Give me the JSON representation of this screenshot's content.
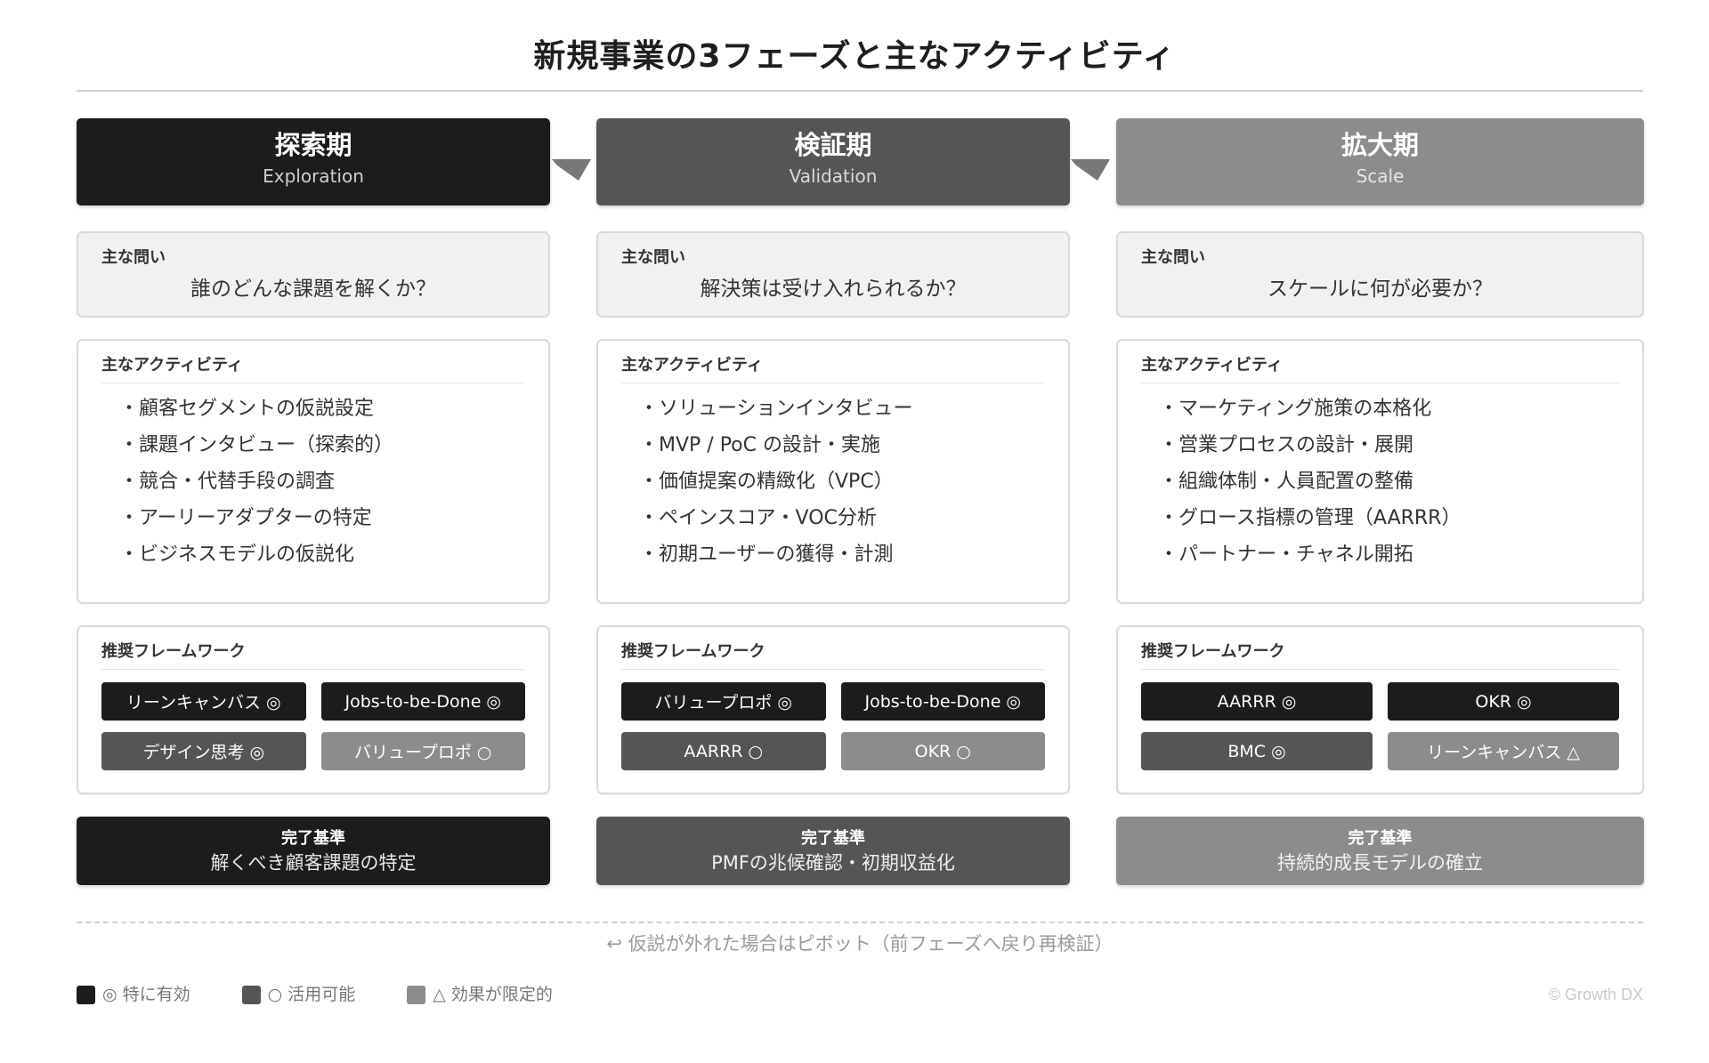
{
  "title": "新規事業の3フェーズと主なアクティビティ",
  "labels": {
    "question": "主な問い",
    "activities": "主なアクティビティ",
    "frameworks": "推奨フレームワーク",
    "criteria": "完了基準"
  },
  "shades": [
    "#1c1c1c",
    "#555555",
    "#8c8c8c"
  ],
  "phases": [
    {
      "name": "探索期",
      "english": "Exploration",
      "question": "誰のどんな課題を解くか？",
      "activities": [
        "・顧客セグメントの仮説設定",
        "・課題インタビュー（探索的）",
        "・競合・代替手段の調査",
        "・アーリーアダプターの特定",
        "・ビジネスモデルの仮説化"
      ],
      "frameworks": [
        {
          "label": "リーンキャンバス ◎",
          "level": 0
        },
        {
          "label": "Jobs-to-be-Done ◎",
          "level": 0
        },
        {
          "label": "デザイン思考 ◎",
          "level": 1
        },
        {
          "label": "バリュープロポ ○",
          "level": 2
        }
      ],
      "criteria": "解くべき顧客課題の特定"
    },
    {
      "name": "検証期",
      "english": "Validation",
      "question": "解決策は受け入れられるか？",
      "activities": [
        "・ソリューションインタビュー",
        "・MVP / PoC の設計・実施",
        "・価値提案の精緻化（VPC）",
        "・ペインスコア・VOC分析",
        "・初期ユーザーの獲得・計測"
      ],
      "frameworks": [
        {
          "label": "バリュープロポ ◎",
          "level": 0
        },
        {
          "label": "Jobs-to-be-Done ◎",
          "level": 0
        },
        {
          "label": "AARRR ○",
          "level": 1
        },
        {
          "label": "OKR ○",
          "level": 2
        }
      ],
      "criteria": "PMFの兆候確認・初期収益化"
    },
    {
      "name": "拡大期",
      "english": "Scale",
      "question": "スケールに何が必要か？",
      "activities": [
        "・マーケティング施策の本格化",
        "・営業プロセスの設計・展開",
        "・組織体制・人員配置の整備",
        "・グロース指標の管理（AARRR）",
        "・パートナー・チャネル開拓"
      ],
      "frameworks": [
        {
          "label": "AARRR ◎",
          "level": 0
        },
        {
          "label": "OKR ◎",
          "level": 0
        },
        {
          "label": "BMC ◎",
          "level": 1
        },
        {
          "label": "リーンキャンバス △",
          "level": 2
        }
      ],
      "criteria": "持続的成長モデルの確立"
    }
  ],
  "pivot_note": "↩ 仮説が外れた場合はピボット（前フェーズへ戻り再検証）",
  "legend": [
    {
      "label": "◎ 特に有効",
      "color": "#1c1c1c"
    },
    {
      "label": "○ 活用可能",
      "color": "#555555"
    },
    {
      "label": "△ 効果が限定的",
      "color": "#8c8c8c"
    }
  ],
  "copyright": "© Growth DX"
}
